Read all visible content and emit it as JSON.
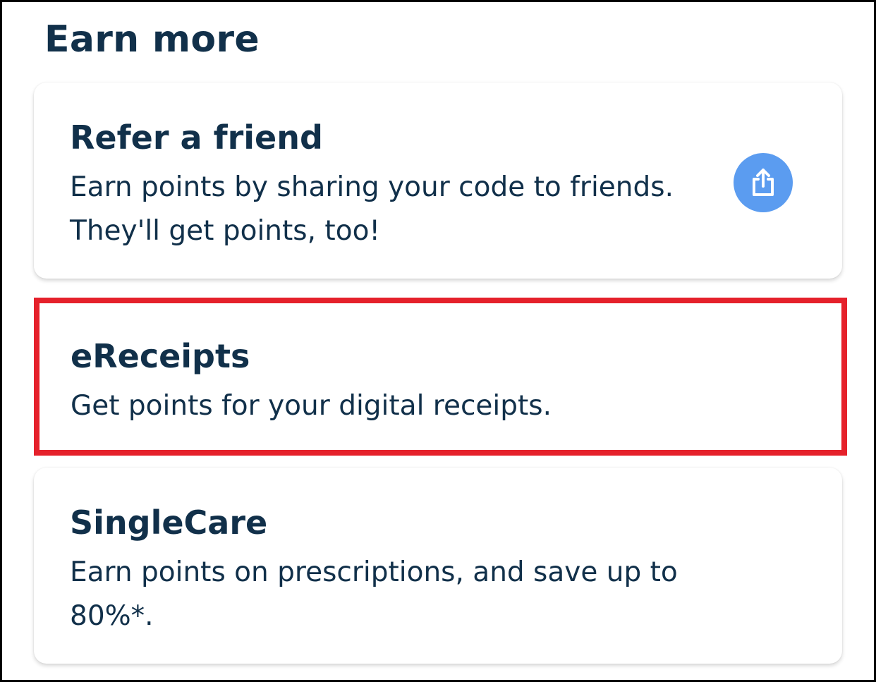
{
  "section": {
    "title": "Earn more"
  },
  "cards": [
    {
      "title": "Refer a friend",
      "description": "Earn points by sharing your code to friends. They'll get points, too!",
      "action_icon": "share-icon"
    },
    {
      "title": "eReceipts",
      "description": "Get points for your digital receipts."
    },
    {
      "title": "SingleCare",
      "description": "Earn points on prescriptions, and save up to 80%*."
    }
  ],
  "colors": {
    "text": "#11304a",
    "share_button": "#5b9cf0",
    "highlight_border": "#e5212b"
  }
}
